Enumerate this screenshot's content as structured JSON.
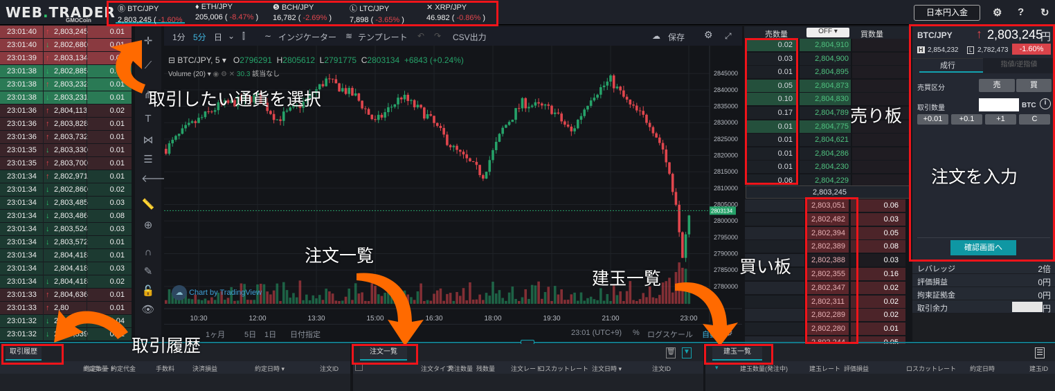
{
  "app": {
    "logo": "WEB.TRADER",
    "logo_sub": "GMOCoin",
    "deposit_button": "日本円入金"
  },
  "tickers": [
    {
      "icon": "bitcoin-icon",
      "pair": "BTC/JPY",
      "price": "2,803,245",
      "change": "-1.60%"
    },
    {
      "icon": "ethereum-icon",
      "pair": "ETH/JPY",
      "price": "205,006",
      "change": "-8.47%"
    },
    {
      "icon": "bitcoin-cash-icon",
      "pair": "BCH/JPY",
      "price": "16,782",
      "change": "-2.69%"
    },
    {
      "icon": "litecoin-icon",
      "pair": "LTC/JPY",
      "price": "7,898",
      "change": "-3.65%"
    },
    {
      "icon": "ripple-icon",
      "pair": "XRP/JPY",
      "price": "46.982",
      "change": "-0.86%"
    }
  ],
  "trades": [
    [
      "23:01:40",
      "up",
      "2,803,245",
      "0.01",
      "sell-hi"
    ],
    [
      "23:01:40",
      "down",
      "2,802,680",
      "0.01",
      "sell-hi"
    ],
    [
      "23:01:39",
      "up",
      "2,803,134",
      "0.01",
      "sell-hi"
    ],
    [
      "23:01:38",
      "down",
      "2,802,885",
      "0.01",
      "buy-hi"
    ],
    [
      "23:01:38",
      "up",
      "2,803,232",
      "0.01",
      "buy-hi"
    ],
    [
      "23:01:38",
      "down",
      "2,803,231",
      "0.01",
      "buy-hi"
    ],
    [
      "23:01:36",
      "up",
      "2,804,113",
      "0.02",
      "sell"
    ],
    [
      "23:01:36",
      "up",
      "2,803,828",
      "0.01",
      "sell"
    ],
    [
      "23:01:36",
      "up",
      "2,803,732",
      "0.01",
      "sell"
    ],
    [
      "23:01:35",
      "down",
      "2,803,330",
      "0.01",
      "sell"
    ],
    [
      "23:01:35",
      "up",
      "2,803,700",
      "0.01",
      "sell"
    ],
    [
      "23:01:34",
      "up",
      "2,802,971",
      "0.01",
      "buy"
    ],
    [
      "23:01:34",
      "down",
      "2,802,860",
      "0.02",
      "buy"
    ],
    [
      "23:01:34",
      "down",
      "2,803,485",
      "0.03",
      "buy"
    ],
    [
      "23:01:34",
      "down",
      "2,803,486",
      "0.08",
      "buy"
    ],
    [
      "23:01:34",
      "down",
      "2,803,524",
      "0.03",
      "buy"
    ],
    [
      "23:01:34",
      "down",
      "2,803,572",
      "0.01",
      "buy"
    ],
    [
      "23:01:34",
      "",
      "2,804,418",
      "0.01",
      "buy"
    ],
    [
      "23:01:34",
      "",
      "2,804,418",
      "0.03",
      "buy"
    ],
    [
      "23:01:34",
      "down",
      "2,804,418",
      "0.02",
      "buy"
    ],
    [
      "23:01:33",
      "up",
      "2,804,636",
      "0.01",
      "sell"
    ],
    [
      "23:01:33",
      "up",
      "2,80",
      "0.01",
      "sell"
    ],
    [
      "23:01:32",
      "down",
      "2,80",
      "0.04",
      "buy"
    ],
    [
      "23:01:32",
      "down",
      "2,803,539",
      "0.02",
      "buy"
    ]
  ],
  "chart_toolbar": {
    "intervals": [
      "1分",
      "5分",
      "日"
    ],
    "indicators": "インジケーター",
    "template": "テンプレート",
    "csv": "CSV出力",
    "save": "保存"
  },
  "chart_data": {
    "type": "candlestick",
    "symbol": "BTC/JPY, 5",
    "ohlc_label": {
      "o": "2796291",
      "h": "2805612",
      "l": "2791775",
      "c": "2803134",
      "change": "+6843 (+0.24%)"
    },
    "volume_label": "Volume (20)",
    "volume_value": "30.3",
    "volume_note": "該当なし",
    "y_ticks": [
      2780000,
      2785000,
      2790000,
      2795000,
      2800000,
      2805000,
      2810000,
      2815000,
      2820000,
      2825000,
      2830000,
      2835000,
      2840000,
      2845000
    ],
    "ylim": [
      2778500,
      2848000
    ],
    "x_ticks": [
      "10:30",
      "12:00",
      "13:30",
      "15:00",
      "16:30",
      "18:00",
      "19:30",
      "21:00",
      "23:00"
    ],
    "last_price": "2803134",
    "price_path": [
      [
        "09:40",
        2822000
      ],
      [
        "10:10",
        2828000
      ],
      [
        "11:00",
        2835000
      ],
      [
        "12:00",
        2838000
      ],
      [
        "12:30",
        2831000
      ],
      [
        "13:10",
        2836000
      ],
      [
        "13:45",
        2843000
      ],
      [
        "14:30",
        2838000
      ],
      [
        "15:00",
        2830000
      ],
      [
        "15:40",
        2838000
      ],
      [
        "16:20",
        2832000
      ],
      [
        "17:00",
        2822000
      ],
      [
        "17:45",
        2814000
      ],
      [
        "18:15",
        2828000
      ],
      [
        "18:45",
        2836000
      ],
      [
        "19:30",
        2834000
      ],
      [
        "20:00",
        2827000
      ],
      [
        "20:30",
        2838000
      ],
      [
        "21:00",
        2843000
      ],
      [
        "21:30",
        2835000
      ],
      [
        "22:00",
        2830000
      ],
      [
        "22:20",
        2822000
      ],
      [
        "22:40",
        2806000
      ],
      [
        "22:50",
        2790000
      ],
      [
        "23:00",
        2803134
      ]
    ],
    "colors": {
      "up": "#26a269",
      "down": "#e0464d"
    },
    "watermark": "Chart by TradingView"
  },
  "chart_bottom": {
    "ranges": [
      "1ヶ月",
      "5日",
      "1日"
    ],
    "date": "日付指定",
    "time": "23:01 (UTC+9)",
    "percent": "%",
    "log": "ログスケール",
    "auto": "自動"
  },
  "orderbook": {
    "sell_qty_header": "売数量",
    "buy_qty_header": "買数量",
    "filter": "OFF",
    "mid": "2,803,245",
    "asks": [
      [
        "0.02",
        "2,804,910"
      ],
      [
        "0.03",
        "2,804,900"
      ],
      [
        "0.01",
        "2,804,895"
      ],
      [
        "0.05",
        "2,804,873"
      ],
      [
        "0.10",
        "2,804,830"
      ],
      [
        "0.17",
        "2,804,789"
      ],
      [
        "0.01",
        "2,804,775"
      ],
      [
        "0.01",
        "2,804,621"
      ],
      [
        "0.01",
        "2,804,286"
      ],
      [
        "0.01",
        "2,804,230"
      ],
      [
        "0.06",
        "2,804,229"
      ]
    ],
    "bids": [
      [
        "2,803,051",
        "0.06"
      ],
      [
        "2,802,482",
        "0.03"
      ],
      [
        "2,802,394",
        "0.05"
      ],
      [
        "2,802,389",
        "0.08"
      ],
      [
        "2,802,388",
        "0.03"
      ],
      [
        "2,802,355",
        "0.16"
      ],
      [
        "2,802,347",
        "0.02"
      ],
      [
        "2,802,311",
        "0.02"
      ],
      [
        "2,802,289",
        "0.02"
      ],
      [
        "2,802,280",
        "0.01"
      ],
      [
        "2,802,244",
        "0.05"
      ]
    ]
  },
  "order": {
    "pair": "BTC/JPY",
    "price": "2,803,245",
    "unit": "円",
    "high": "2,854,232",
    "low": "2,782,473",
    "change": "-1.60%",
    "tabs": [
      "成行",
      "指値/逆指値"
    ],
    "side_label": "売買区分",
    "sell": "売",
    "buy": "買",
    "qty_label": "取引数量",
    "qty_unit": "BTC",
    "increments": [
      "+0.01",
      "+0.1",
      "+1",
      "C"
    ],
    "confirm": "確認画面へ"
  },
  "account": [
    [
      "レバレッジ",
      "2倍"
    ],
    [
      "評価損益",
      "0円"
    ],
    [
      "拘束証拠金",
      "0円"
    ],
    [
      "取引余力",
      "円"
    ]
  ],
  "bottom": {
    "history": {
      "tab": "取引履歴",
      "cols": [
        "約定数量",
        "約定レート",
        "約定代金",
        "手数料",
        "決済損益",
        "約定日時 ▾",
        "注文ID"
      ]
    },
    "orders": {
      "tab": "注文一覧",
      "cols": [
        "注文タイプ",
        "発注数量",
        "残数量",
        "注文レート",
        "ロスカットレート",
        "注文日時 ▾",
        "注文ID"
      ]
    },
    "positions": {
      "tab": "建玉一覧",
      "cols": [
        "建玉数量(発注中)",
        "建玉レート",
        "評価損益",
        "ロスカットレート",
        "約定日時",
        "建玉ID"
      ]
    }
  },
  "annotations": {
    "select_currency": "取引したい通貨を選択",
    "ask_board": "売り板",
    "bid_board": "買い板",
    "enter_order": "注文を入力",
    "order_list": "注文一覧",
    "position_list": "建玉一覧",
    "trade_history": "取引履歴"
  }
}
